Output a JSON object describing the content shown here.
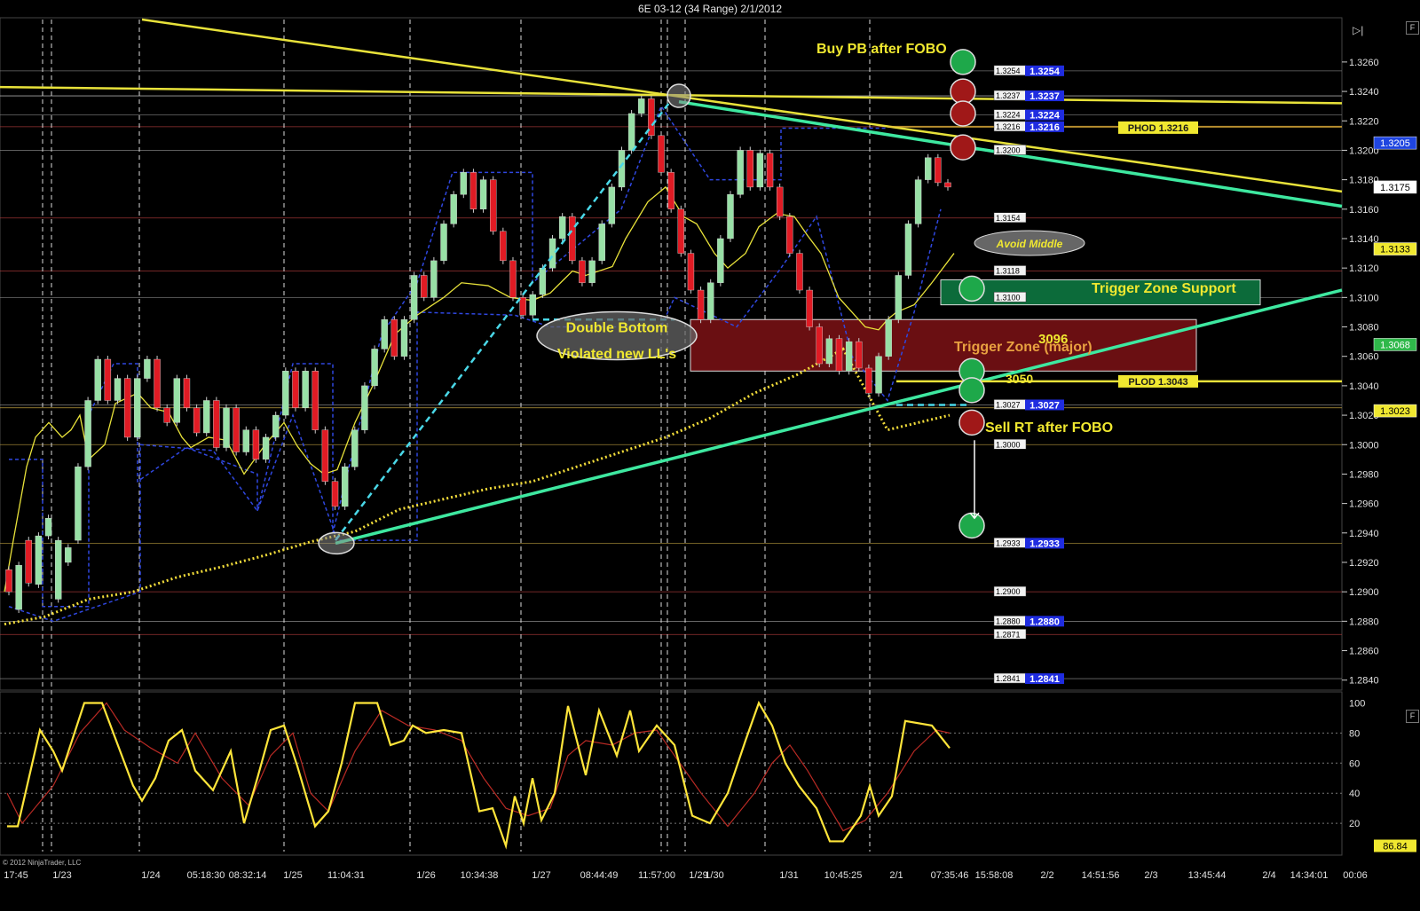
{
  "header": {
    "title": "6E 03-12 (34 Range)  2/1/2012"
  },
  "controls": {
    "price_panel_btn": "F",
    "osc_panel_btn": "F",
    "scroll_icon": "scroll-end-icon"
  },
  "copyright": "© 2012 NinjaTrader, LLC",
  "colors": {
    "bull_candle": "#98e0a6",
    "bear_candle": "#e01b24",
    "trend_green": "#3ee8a0",
    "trend_yellow": "#e8e23a",
    "channel_blue": "#2f47e0",
    "stoch_k": "#ffe53a",
    "stoch_d": "#b92a24"
  },
  "chart_data": {
    "type": "candlestick",
    "instrument": "6E 03-12",
    "bar_type": "34 Range",
    "date": "2/1/2012",
    "ylim": [
      1.2835,
      1.3275
    ],
    "yticks": [
      "1.3260",
      "1.3240",
      "1.3220",
      "1.3200",
      "1.3180",
      "1.3160",
      "1.3140",
      "1.3120",
      "1.3100",
      "1.3080",
      "1.3060",
      "1.3040",
      "1.3020",
      "1.3000",
      "1.2980",
      "1.2960",
      "1.2940",
      "1.2920",
      "1.2900",
      "1.2880",
      "1.2860",
      "1.2840"
    ],
    "xtick_labels": [
      "17:45",
      "1/23",
      "1/24",
      "05:18:30",
      "08:32:14",
      "1/25",
      "11:04:31",
      "1/26",
      "10:34:38",
      "1/27",
      "08:44:49",
      "11:57:00",
      "1/29",
      "1/30",
      "1/31",
      "10:45:25",
      "2/1",
      "07:35:46",
      "15:58:08",
      "2/2",
      "14:51:56",
      "2/3",
      "13:45:44",
      "2/4",
      "14:34:01",
      "00:06"
    ],
    "candles": [
      [
        1.2915,
        1.29
      ],
      [
        1.2888,
        1.2918
      ],
      [
        1.2935,
        1.2906
      ],
      [
        1.2905,
        1.2938
      ],
      [
        1.2938,
        1.295
      ],
      [
        1.2895,
        1.2935
      ],
      [
        1.292,
        1.293
      ],
      [
        1.2935,
        1.2985
      ],
      [
        1.2985,
        1.303
      ],
      [
        1.303,
        1.3058
      ],
      [
        1.3058,
        1.303
      ],
      [
        1.303,
        1.3045
      ],
      [
        1.3045,
        1.3005
      ],
      [
        1.3005,
        1.3045
      ],
      [
        1.3045,
        1.3058
      ],
      [
        1.3058,
        1.3025
      ],
      [
        1.3025,
        1.3015
      ],
      [
        1.3015,
        1.3045
      ],
      [
        1.3045,
        1.3025
      ],
      [
        1.3025,
        1.3008
      ],
      [
        1.3008,
        1.303
      ],
      [
        1.303,
        1.2998
      ],
      [
        1.2998,
        1.3025
      ],
      [
        1.3025,
        1.2995
      ],
      [
        1.2995,
        1.301
      ],
      [
        1.301,
        1.299
      ],
      [
        1.299,
        1.3005
      ],
      [
        1.3005,
        1.302
      ],
      [
        1.302,
        1.305
      ],
      [
        1.305,
        1.3025
      ],
      [
        1.3025,
        1.305
      ],
      [
        1.305,
        1.301
      ],
      [
        1.301,
        1.2975
      ],
      [
        1.2975,
        1.2958
      ],
      [
        1.2958,
        1.2985
      ],
      [
        1.2985,
        1.301
      ],
      [
        1.301,
        1.304
      ],
      [
        1.304,
        1.3065
      ],
      [
        1.3065,
        1.3085
      ],
      [
        1.3085,
        1.306
      ],
      [
        1.306,
        1.3085
      ],
      [
        1.3085,
        1.3115
      ],
      [
        1.3115,
        1.31
      ],
      [
        1.31,
        1.3125
      ],
      [
        1.3125,
        1.315
      ],
      [
        1.315,
        1.317
      ],
      [
        1.317,
        1.3185
      ],
      [
        1.3185,
        1.316
      ],
      [
        1.316,
        1.318
      ],
      [
        1.318,
        1.3145
      ],
      [
        1.3145,
        1.3125
      ],
      [
        1.3125,
        1.31
      ],
      [
        1.31,
        1.3088
      ],
      [
        1.3088,
        1.3102
      ],
      [
        1.3102,
        1.312
      ],
      [
        1.312,
        1.314
      ],
      [
        1.314,
        1.3155
      ],
      [
        1.3155,
        1.3125
      ],
      [
        1.3125,
        1.311
      ],
      [
        1.311,
        1.3125
      ],
      [
        1.3125,
        1.315
      ],
      [
        1.315,
        1.3175
      ],
      [
        1.3175,
        1.32
      ],
      [
        1.32,
        1.3225
      ],
      [
        1.3225,
        1.3235
      ],
      [
        1.3235,
        1.321
      ],
      [
        1.321,
        1.3185
      ],
      [
        1.3185,
        1.316
      ],
      [
        1.316,
        1.313
      ],
      [
        1.313,
        1.3105
      ],
      [
        1.3105,
        1.3085
      ],
      [
        1.3085,
        1.311
      ],
      [
        1.311,
        1.314
      ],
      [
        1.314,
        1.317
      ],
      [
        1.317,
        1.32
      ],
      [
        1.32,
        1.3175
      ],
      [
        1.3175,
        1.3198
      ],
      [
        1.3198,
        1.3175
      ],
      [
        1.3175,
        1.3155
      ],
      [
        1.3155,
        1.313
      ],
      [
        1.313,
        1.3105
      ],
      [
        1.3105,
        1.308
      ],
      [
        1.308,
        1.3055
      ],
      [
        1.3055,
        1.3072
      ],
      [
        1.3072,
        1.305
      ],
      [
        1.305,
        1.307
      ],
      [
        1.307,
        1.3052
      ],
      [
        1.3052,
        1.3035
      ],
      [
        1.3035,
        1.306
      ],
      [
        1.306,
        1.3085
      ],
      [
        1.3085,
        1.3115
      ],
      [
        1.3115,
        1.315
      ],
      [
        1.315,
        1.318
      ],
      [
        1.318,
        1.3195
      ],
      [
        1.3195,
        1.3178
      ],
      [
        1.3178,
        1.3175
      ]
    ],
    "ma_fast": [
      [
        5,
        1.29
      ],
      [
        15,
        1.2935
      ],
      [
        30,
        1.2985
      ],
      [
        40,
        1.3005
      ],
      [
        55,
        1.3015
      ],
      [
        70,
        1.3005
      ],
      [
        80,
        1.301
      ],
      [
        90,
        1.302
      ],
      [
        100,
        1.299
      ],
      [
        118,
        1.3
      ],
      [
        130,
        1.3028
      ],
      [
        155,
        1.3035
      ],
      [
        170,
        1.3025
      ],
      [
        190,
        1.3022
      ],
      [
        205,
        1.3005
      ],
      [
        215,
        1.2998
      ],
      [
        235,
        1.3005
      ],
      [
        255,
        1.3003
      ],
      [
        275,
        1.298
      ],
      [
        300,
        1.3001
      ],
      [
        320,
        1.3015
      ],
      [
        335,
        1.2999
      ],
      [
        350,
        1.2987
      ],
      [
        365,
        1.298
      ],
      [
        380,
        1.2983
      ],
      [
        400,
        1.3015
      ],
      [
        420,
        1.304
      ],
      [
        445,
        1.3075
      ],
      [
        470,
        1.3088
      ],
      [
        500,
        1.31
      ],
      [
        520,
        1.311
      ],
      [
        550,
        1.3108
      ],
      [
        575,
        1.31
      ],
      [
        600,
        1.3098
      ],
      [
        620,
        1.3103
      ],
      [
        645,
        1.3118
      ],
      [
        660,
        1.3115
      ],
      [
        690,
        1.3121
      ],
      [
        705,
        1.314
      ],
      [
        730,
        1.3165
      ],
      [
        750,
        1.3175
      ],
      [
        770,
        1.3155
      ],
      [
        785,
        1.315
      ],
      [
        805,
        1.313
      ],
      [
        820,
        1.312
      ],
      [
        840,
        1.313
      ],
      [
        855,
        1.3148
      ],
      [
        875,
        1.3157
      ],
      [
        895,
        1.3155
      ],
      [
        910,
        1.3142
      ],
      [
        925,
        1.313
      ],
      [
        945,
        1.31
      ],
      [
        960,
        1.309
      ],
      [
        975,
        1.308
      ],
      [
        990,
        1.3078
      ],
      [
        1000,
        1.3085
      ],
      [
        1010,
        1.309
      ],
      [
        1030,
        1.3095
      ],
      [
        1050,
        1.311
      ],
      [
        1075,
        1.313
      ]
    ],
    "ma_slow": [
      [
        5,
        1.2878
      ],
      [
        50,
        1.2883
      ],
      [
        100,
        1.2895
      ],
      [
        150,
        1.29
      ],
      [
        200,
        1.291
      ],
      [
        250,
        1.2917
      ],
      [
        300,
        1.2925
      ],
      [
        350,
        1.2934
      ],
      [
        400,
        1.2941
      ],
      [
        450,
        1.2956
      ],
      [
        500,
        1.2963
      ],
      [
        550,
        1.297
      ],
      [
        600,
        1.2975
      ],
      [
        650,
        1.2985
      ],
      [
        700,
        1.2995
      ],
      [
        750,
        1.3005
      ],
      [
        800,
        1.3018
      ],
      [
        850,
        1.3035
      ],
      [
        900,
        1.3048
      ],
      [
        950,
        1.3065
      ],
      [
        1000,
        1.301
      ],
      [
        1070,
        1.302
      ]
    ],
    "osc": {
      "ylim": [
        0,
        105
      ],
      "yticks": [
        "100",
        "80",
        "60",
        "40",
        "20"
      ],
      "k": [
        [
          8,
          18
        ],
        [
          20,
          18
        ],
        [
          45,
          82
        ],
        [
          60,
          68
        ],
        [
          70,
          55
        ],
        [
          95,
          100
        ],
        [
          115,
          100
        ],
        [
          150,
          45
        ],
        [
          160,
          35
        ],
        [
          175,
          50
        ],
        [
          190,
          75
        ],
        [
          205,
          82
        ],
        [
          220,
          55
        ],
        [
          240,
          42
        ],
        [
          260,
          68
        ],
        [
          275,
          20
        ],
        [
          290,
          50
        ],
        [
          305,
          82
        ],
        [
          320,
          85
        ],
        [
          335,
          58
        ],
        [
          355,
          18
        ],
        [
          370,
          28
        ],
        [
          385,
          60
        ],
        [
          400,
          100
        ],
        [
          425,
          100
        ],
        [
          440,
          72
        ],
        [
          455,
          75
        ],
        [
          465,
          85
        ],
        [
          480,
          80
        ],
        [
          500,
          82
        ],
        [
          520,
          80
        ],
        [
          540,
          28
        ],
        [
          555,
          30
        ],
        [
          570,
          5
        ],
        [
          580,
          38
        ],
        [
          590,
          20
        ],
        [
          600,
          50
        ],
        [
          610,
          22
        ],
        [
          625,
          40
        ],
        [
          640,
          98
        ],
        [
          660,
          52
        ],
        [
          675,
          95
        ],
        [
          695,
          65
        ],
        [
          710,
          95
        ],
        [
          720,
          68
        ],
        [
          740,
          85
        ],
        [
          760,
          72
        ],
        [
          780,
          25
        ],
        [
          800,
          20
        ],
        [
          820,
          40
        ],
        [
          840,
          75
        ],
        [
          855,
          100
        ],
        [
          870,
          85
        ],
        [
          885,
          60
        ],
        [
          900,
          45
        ],
        [
          920,
          30
        ],
        [
          935,
          8
        ],
        [
          950,
          8
        ],
        [
          970,
          25
        ],
        [
          980,
          45
        ],
        [
          990,
          25
        ],
        [
          1005,
          38
        ],
        [
          1020,
          88
        ],
        [
          1050,
          85
        ],
        [
          1070,
          70
        ]
      ],
      "d": [
        [
          8,
          40
        ],
        [
          25,
          20
        ],
        [
          60,
          45
        ],
        [
          90,
          80
        ],
        [
          120,
          100
        ],
        [
          140,
          82
        ],
        [
          170,
          70
        ],
        [
          200,
          60
        ],
        [
          220,
          80
        ],
        [
          250,
          50
        ],
        [
          280,
          32
        ],
        [
          305,
          65
        ],
        [
          330,
          80
        ],
        [
          350,
          40
        ],
        [
          370,
          28
        ],
        [
          400,
          68
        ],
        [
          430,
          95
        ],
        [
          460,
          85
        ],
        [
          490,
          82
        ],
        [
          520,
          75
        ],
        [
          545,
          50
        ],
        [
          570,
          30
        ],
        [
          595,
          25
        ],
        [
          620,
          30
        ],
        [
          640,
          65
        ],
        [
          660,
          75
        ],
        [
          690,
          72
        ],
        [
          715,
          80
        ],
        [
          740,
          82
        ],
        [
          760,
          65
        ],
        [
          790,
          40
        ],
        [
          820,
          18
        ],
        [
          850,
          40
        ],
        [
          870,
          60
        ],
        [
          890,
          72
        ],
        [
          910,
          55
        ],
        [
          930,
          35
        ],
        [
          950,
          15
        ],
        [
          975,
          22
        ],
        [
          1000,
          40
        ],
        [
          1030,
          68
        ],
        [
          1055,
          82
        ],
        [
          1070,
          80
        ]
      ]
    },
    "levels": [
      {
        "price": "1.3254",
        "y": 1.3254,
        "tag": "1.3254",
        "blue_tag": "1.3254"
      },
      {
        "price": "1.3237",
        "y": 1.3237,
        "tag": "1.3237",
        "blue_tag": "1.3237"
      },
      {
        "price": "1.3224",
        "y": 1.3224,
        "tag": "1.3224",
        "blue_tag": "1.3224"
      },
      {
        "price": "1.3216",
        "y": 1.3216,
        "tag": "1.3216",
        "blue_tag": "1.3216"
      },
      {
        "price": "1.3200",
        "y": 1.32,
        "tag": "1.3200",
        "blue_tag": ""
      },
      {
        "price": "1.3154",
        "y": 1.3154,
        "tag": "1.3154",
        "blue_tag": ""
      },
      {
        "price": "1.3118",
        "y": 1.3118,
        "tag": "1.3118",
        "blue_tag": ""
      },
      {
        "price": "1.3100",
        "y": 1.31,
        "tag": "1.3100",
        "blue_tag": ""
      },
      {
        "price": "1.3027",
        "y": 1.3027,
        "tag": "1.3027",
        "blue_tag": "1.3027"
      },
      {
        "price": "1.3000",
        "y": 1.3,
        "tag": "1.3000",
        "blue_tag": ""
      },
      {
        "price": "1.2933",
        "y": 1.2933,
        "tag": "1.2933",
        "blue_tag": "1.2933"
      },
      {
        "price": "1.2900",
        "y": 1.29,
        "tag": "1.2900",
        "blue_tag": ""
      },
      {
        "price": "1.2880",
        "y": 1.288,
        "tag": "1.2880",
        "blue_tag": "1.2880"
      },
      {
        "price": "1.2871",
        "y": 1.2871,
        "tag": "1.2871",
        "blue_tag": ""
      },
      {
        "price": "1.2841",
        "y": 1.2841,
        "tag": "1.2841",
        "blue_tag": "1.2841"
      }
    ],
    "axis_tags": [
      {
        "label": "1.3205",
        "y": 1.3205,
        "bg": "#1f45e0",
        "fg": "#ffffff"
      },
      {
        "label": "1.3175",
        "y": 1.3175,
        "bg": "#ffffff",
        "fg": "#000000"
      },
      {
        "label": "1.3133",
        "y": 1.3133,
        "bg": "#f0e830",
        "fg": "#000000"
      },
      {
        "label": "1.3068",
        "y": 1.3068,
        "bg": "#2fb84a",
        "fg": "#ffffff"
      },
      {
        "label": "1.3023",
        "y": 1.3023,
        "bg": "#f0e830",
        "fg": "#000000"
      }
    ],
    "osc_value_tag": "86.84",
    "annotations": {
      "buy_pb": "Buy PB after FOBO",
      "phod": "PHOD 1.3216",
      "plod": "PLOD 1.3043",
      "avoid_middle": "Avoid Middle",
      "tz_support": "Trigger Zone Support",
      "tz_support_level": "3096",
      "tz_major": "Trigger Zone (major)",
      "level_3050": "3050",
      "sell_rt": "Sell RT after FOBO",
      "double_bottom_1": "Double Bottom",
      "double_bottom_2": "Violated new LL's"
    }
  }
}
